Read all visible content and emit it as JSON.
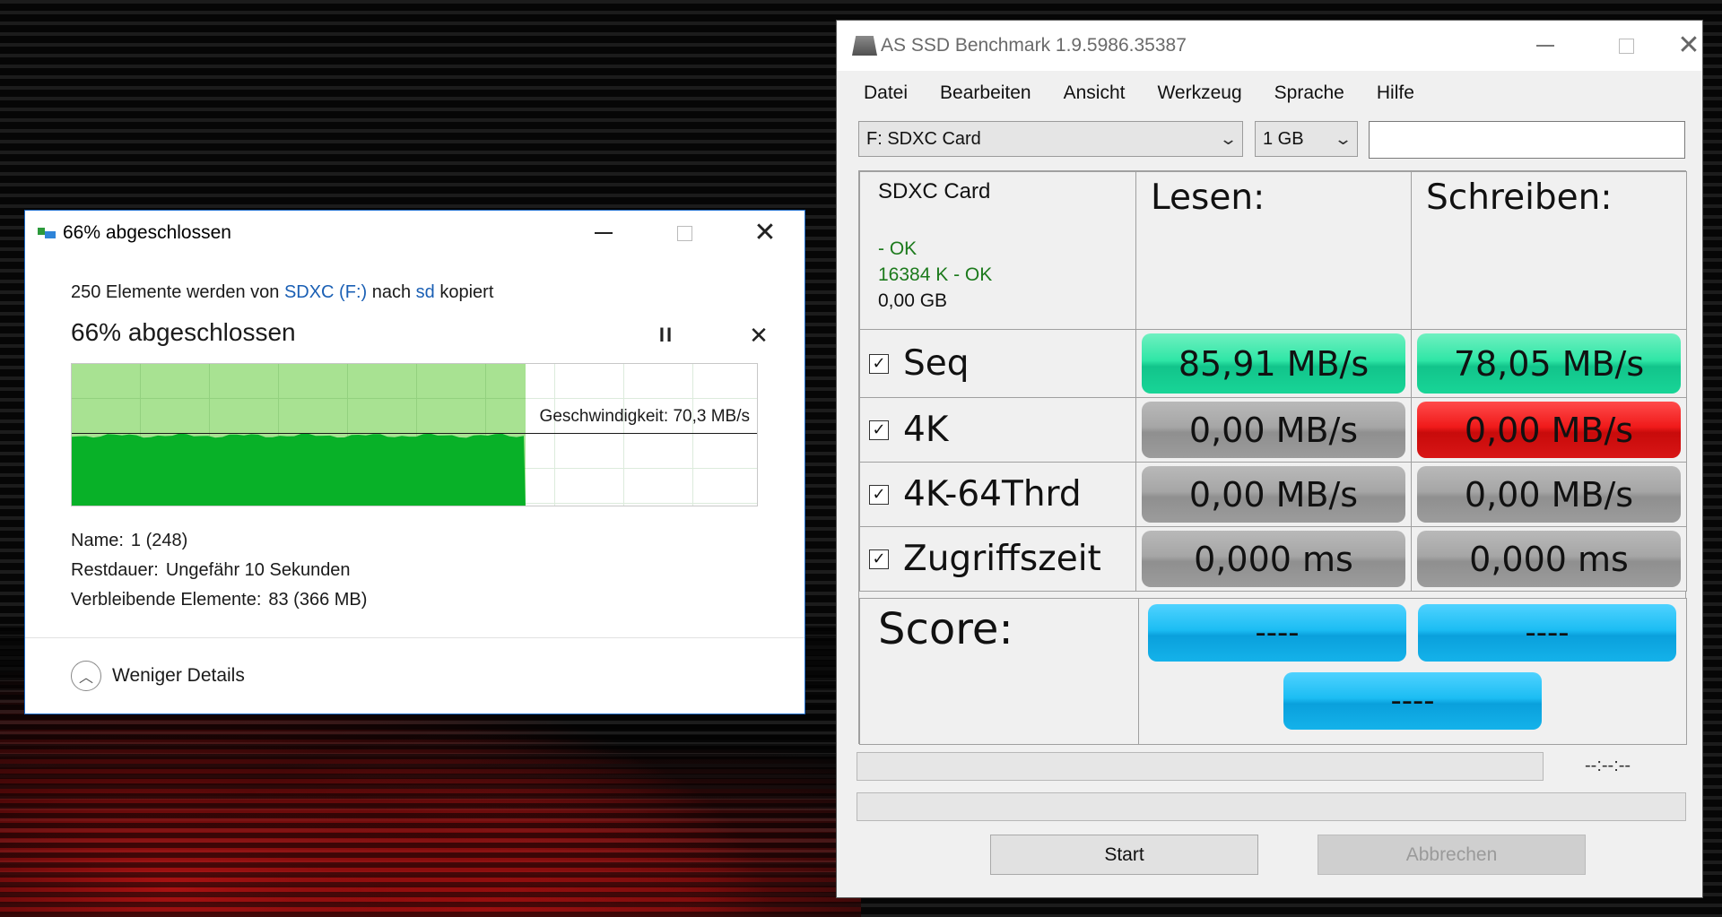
{
  "copy_dialog": {
    "title": "66% abgeschlossen",
    "desc": {
      "prefix": "250 Elemente werden von",
      "source": "SDXC (F:)",
      "middle": "nach",
      "target": "sd",
      "suffix": "kopiert"
    },
    "heading": "66% abgeschlossen",
    "progress_percent": 66,
    "pause_glyph": "II",
    "stop_glyph": "✕",
    "speed_label": "Geschwindigkeit: 70,3 MB/s",
    "name_label": "Name:",
    "name_value": "1 (248)",
    "remaining_label": "Restdauer:",
    "remaining_value": "Ungefähr 10 Sekunden",
    "items_label": "Verbleibende Elemente:",
    "items_value": "83 (366 MB)",
    "less_details": "Weniger Details",
    "less_details_glyph": "︿"
  },
  "ssd_window": {
    "title": "AS SSD Benchmark 1.9.5986.35387",
    "menu": [
      "Datei",
      "Bearbeiten",
      "Ansicht",
      "Werkzeug",
      "Sprache",
      "Hilfe"
    ],
    "drive_select": "F: SDXC Card",
    "size_select": "1 GB",
    "info": {
      "name": "SDXC Card",
      "status1": " - OK",
      "status2": "16384 K - OK",
      "capacity": "0,00 GB"
    },
    "headers": {
      "read": "Lesen:",
      "write": "Schreiben:"
    },
    "rows": [
      {
        "label": "Seq",
        "read": "85,91 MB/s",
        "write": "78,05 MB/s",
        "read_color": "green",
        "write_color": "green",
        "checked": true
      },
      {
        "label": "4K",
        "read": "0,00 MB/s",
        "write": "0,00 MB/s",
        "read_color": "gray",
        "write_color": "red",
        "checked": true
      },
      {
        "label": "4K-64Thrd",
        "read": "0,00 MB/s",
        "write": "0,00 MB/s",
        "read_color": "gray",
        "write_color": "gray",
        "checked": true
      },
      {
        "label": "Zugriffszeit",
        "read": "0,000 ms",
        "write": "0,000 ms",
        "read_color": "gray",
        "write_color": "gray",
        "checked": true
      }
    ],
    "check_glyph": "✓",
    "score": {
      "label": "Score:",
      "read": "----",
      "write": "----",
      "total": "----"
    },
    "timer": "--:--:--",
    "start_button": "Start",
    "cancel_button": "Abbrechen"
  }
}
